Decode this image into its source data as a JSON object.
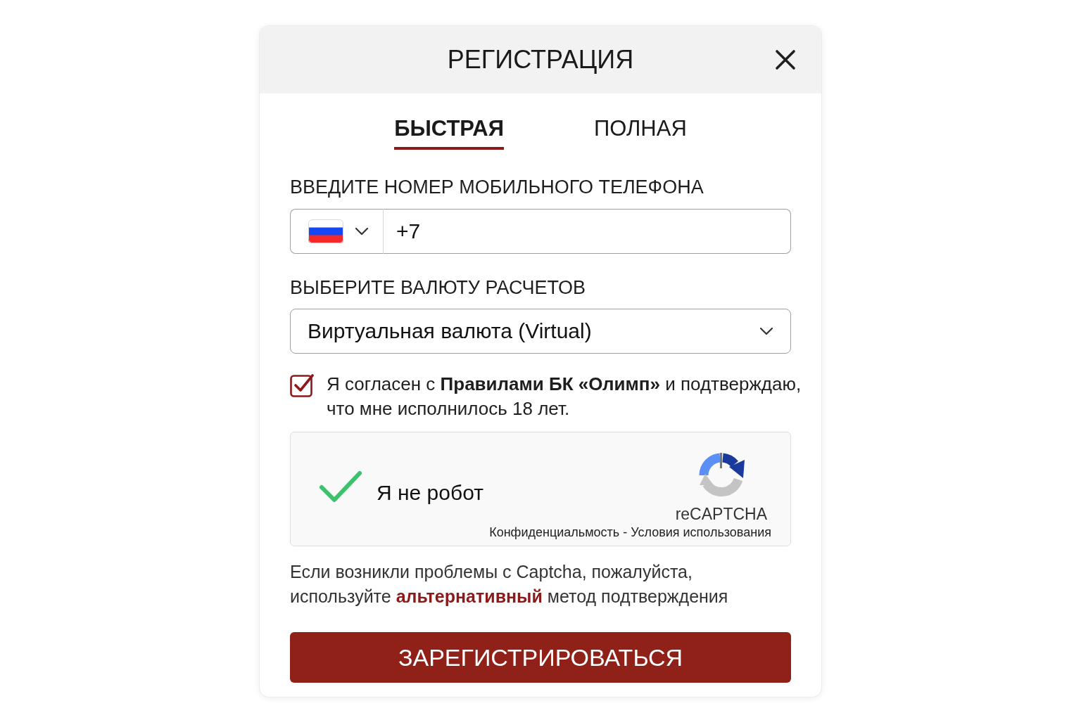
{
  "dialog": {
    "title": "РЕГИСТРАЦИЯ"
  },
  "tabs": [
    {
      "label": "БЫСТРАЯ",
      "selected": true
    },
    {
      "label": "ПОЛНАЯ",
      "selected": false
    }
  ],
  "phone": {
    "label": "ВВЕДИТЕ НОМЕР МОБИЛЬНОГО ТЕЛЕФОНА",
    "value": "+7"
  },
  "currency": {
    "label": "ВЫБЕРИТЕ ВАЛЮТУ РАСЧЕТОВ",
    "value": "Виртуальная валюта (Virtual)"
  },
  "agreement": {
    "checked": true,
    "text": "Я согласен с **Правилами БК «Олимп»** и подтверждаю,\nчто мне исполнилось 18 лет."
  },
  "captcha": {
    "checked": true,
    "label": "Я не робот",
    "brand": "reCAPTCHA",
    "links": "Конфиденциальмость - Условия использования"
  },
  "help": {
    "text": "Если возникли проблемы с Captcha, пожалуйста,\nиспользуйте ",
    "link": "альтернативный",
    "text_end": " метод подтверждения"
  },
  "submit": "ЗАРЕГИСТРИРОВАТЬСЯ"
}
